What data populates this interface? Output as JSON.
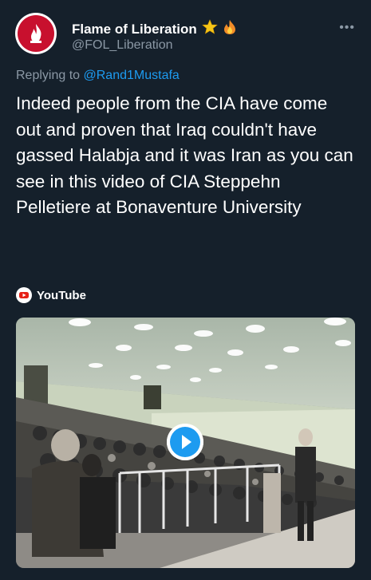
{
  "author": {
    "name": "Flame of Liberation",
    "handle": "@FOL_Liberation",
    "badges": [
      "star-emoji",
      "fire-emoji"
    ]
  },
  "reply": {
    "prefix": "Replying to",
    "mention": "@Rand1Mustafa"
  },
  "tweet": {
    "text": "Indeed people from the CIA have come out and proven that Iraq couldn't have gassed Halabja and it was Iran as you can see in this video of CIA Steppehn Pelletiere at Bonaventure University"
  },
  "media": {
    "source_label": "YouTube",
    "type": "video"
  },
  "colors": {
    "background": "#15202b",
    "link": "#1d9bf0",
    "secondary_text": "#8b98a5",
    "play_icon": "#1d9bf0"
  }
}
